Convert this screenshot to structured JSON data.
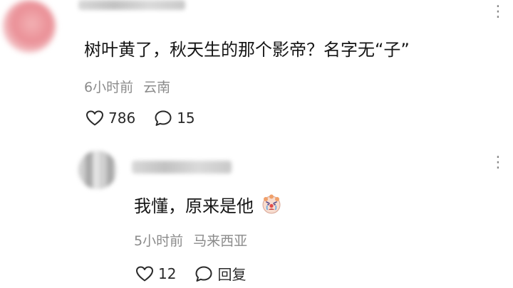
{
  "comment": {
    "text": "树叶黄了，秋天生的那个影帝？名字无“子”",
    "time": "6小时前",
    "location": "云南",
    "likes": "786",
    "replies": "15"
  },
  "reply": {
    "text": "我懂，原来是他",
    "emoji": "clown-crying-emoji",
    "time": "5小时前",
    "location": "马来西亚",
    "likes": "12",
    "reply_label": "回复"
  },
  "icons": {
    "like": "heart-outline-icon",
    "comment": "speech-bubble-icon",
    "more": "more-dots-icon"
  },
  "colors": {
    "text": "#151515",
    "meta": "#8b8b8b",
    "icon": "#2a2a2a"
  }
}
